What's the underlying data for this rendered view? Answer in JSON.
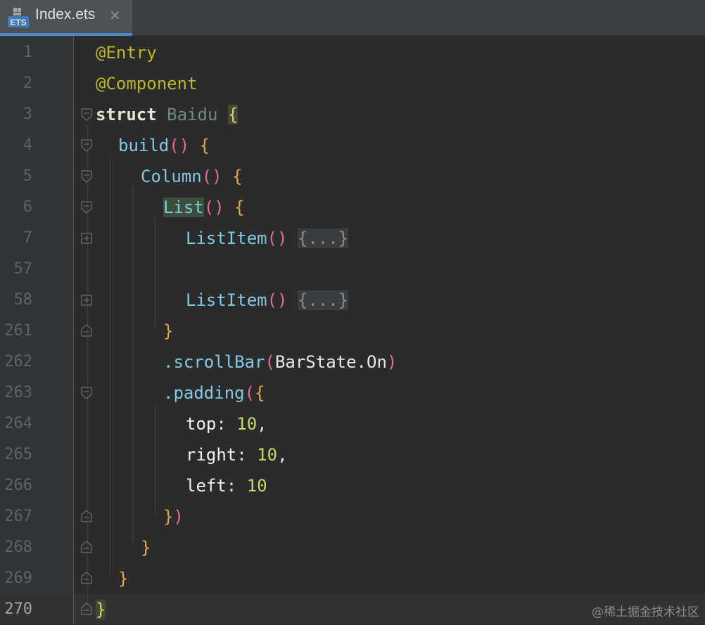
{
  "tab": {
    "icon_label": "ETS",
    "title": "Index.ets",
    "close_glyph": "✕"
  },
  "lines": [
    {
      "num": "1"
    },
    {
      "num": "2"
    },
    {
      "num": "3"
    },
    {
      "num": "4"
    },
    {
      "num": "5"
    },
    {
      "num": "6"
    },
    {
      "num": "7"
    },
    {
      "num": "57"
    },
    {
      "num": "58"
    },
    {
      "num": "261"
    },
    {
      "num": "262"
    },
    {
      "num": "263"
    },
    {
      "num": "264"
    },
    {
      "num": "265"
    },
    {
      "num": "266"
    },
    {
      "num": "267"
    },
    {
      "num": "268"
    },
    {
      "num": "269"
    },
    {
      "num": "270"
    }
  ],
  "code": {
    "l1_anno": "@Entry",
    "l2_anno": "@Component",
    "l3_kw": "struct",
    "l3_name": "Baidu",
    "l3_brace": "{",
    "l4_fn": "build",
    "l4_paren": "()",
    "l4_brace": "{",
    "l5_fn": "Column",
    "l5_paren": "()",
    "l5_brace": "{",
    "l6_fn": "List",
    "l6_paren": "()",
    "l6_brace": "{",
    "l7_fn": "ListItem",
    "l7_paren": "()",
    "l7_folded": "{...}",
    "l58_fn": "ListItem",
    "l58_paren": "()",
    "l58_folded": "{...}",
    "l261_brace": "}",
    "l262_fn": ".scrollBar",
    "l262_open": "(",
    "l262_arg": "BarState.On",
    "l262_close": ")",
    "l263_fn": ".padding",
    "l263_open": "(",
    "l263_brace": "{",
    "l264_prop": "top",
    "l264_colon": ": ",
    "l264_val": "10",
    "l264_comma": ",",
    "l265_prop": "right",
    "l265_colon": ": ",
    "l265_val": "10",
    "l265_comma": ",",
    "l266_prop": "left",
    "l266_colon": ": ",
    "l266_val": "10",
    "l267_brace": "}",
    "l267_close": ")",
    "l268_brace": "}",
    "l269_brace": "}",
    "l270_brace": "}"
  },
  "watermark": "@稀土掘金技术社区",
  "colors": {
    "background": "#2b2b2b",
    "gutter": "#313335",
    "tab_active": "#4e5254",
    "tab_underline": "#4a88c7",
    "annotation": "#bbb529",
    "function": "#7fcbe6",
    "number": "#c3db6c",
    "brace": "#e5a84b",
    "paren": "#e06c9f"
  }
}
